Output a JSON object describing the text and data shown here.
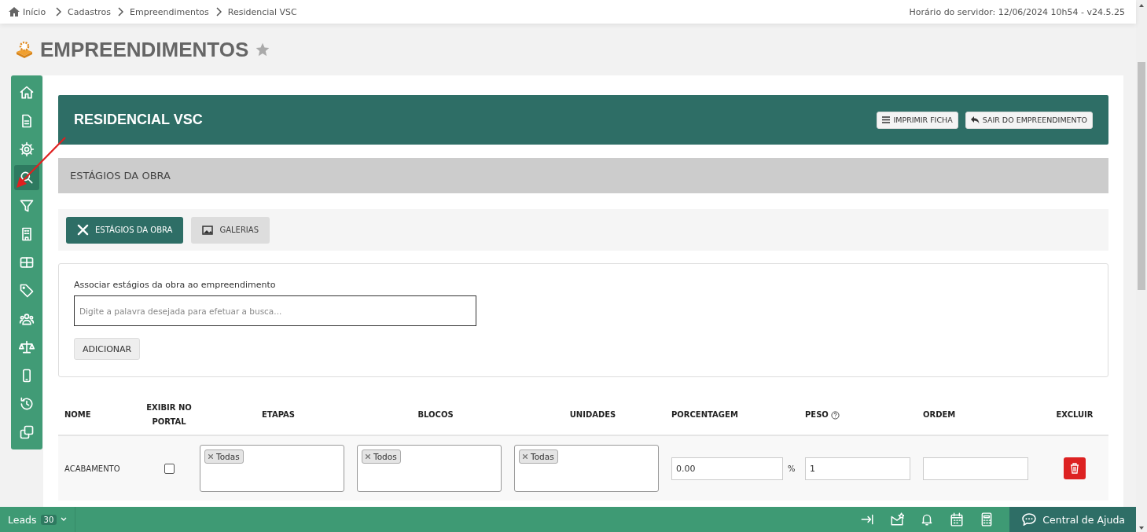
{
  "breadcrumb": [
    {
      "label": "Início"
    },
    {
      "label": "Cadastros"
    },
    {
      "label": "Empreendimentos"
    },
    {
      "label": "Residencial VSC"
    }
  ],
  "server_time": "Horário do servidor: 12/06/2024 10h54 - v24.5.25",
  "page_title": "EMPREENDIMENTOS",
  "favorite": false,
  "sidebar": {
    "items": [
      {
        "selected": false
      },
      {
        "selected": false
      },
      {
        "selected": false
      },
      {
        "selected": true
      },
      {
        "selected": false
      },
      {
        "selected": false
      },
      {
        "selected": false
      },
      {
        "selected": false
      },
      {
        "selected": false
      },
      {
        "selected": false
      },
      {
        "selected": false
      },
      {
        "selected": false
      },
      {
        "selected": false
      }
    ]
  },
  "header": {
    "title": "RESIDENCIAL VSC",
    "buttons": [
      {
        "label": "IMPRIMIR FICHA"
      },
      {
        "label": "SAIR DO EMPREENDIMENTO"
      }
    ]
  },
  "section_title": "ESTÁGIOS DA OBRA",
  "tabs": [
    {
      "label": "ESTÁGIOS DA OBRA",
      "selected": true
    },
    {
      "label": "GALERIAS",
      "selected": false
    }
  ],
  "form": {
    "label": "Associar estágios da obra ao empreendimento",
    "search": {
      "placeholder": "Digite a palavra desejada para efetuar a busca..."
    },
    "button": "ADICIONAR"
  },
  "table": {
    "columns": [
      {
        "label": "NOME",
        "help": false
      },
      {
        "label": "EXIBIR NO PORTAL",
        "help": false
      },
      {
        "label": "ETAPAS",
        "help": false
      },
      {
        "label": "BLOCOS",
        "help": false
      },
      {
        "label": "UNIDADES",
        "help": false
      },
      {
        "label": "PORCENTAGEM",
        "help": false
      },
      {
        "label": "PESO",
        "help": true
      },
      {
        "label": "ORDEM",
        "help": false
      },
      {
        "label": "EXCLUIR",
        "help": false
      }
    ],
    "rows": [
      {
        "name": "ACABAMENTO",
        "show_on_portal": false,
        "etapas": [
          "Todas"
        ],
        "blocos": [
          "Todos"
        ],
        "unidades": [
          "Todas"
        ],
        "porcentagem": "0.00",
        "porcentagem_unit": "%",
        "peso": "1"
      }
    ]
  },
  "bottom_bar": {
    "leads_label": "Leads",
    "leads_count": "30",
    "help_button": "Central de Ajuda"
  }
}
